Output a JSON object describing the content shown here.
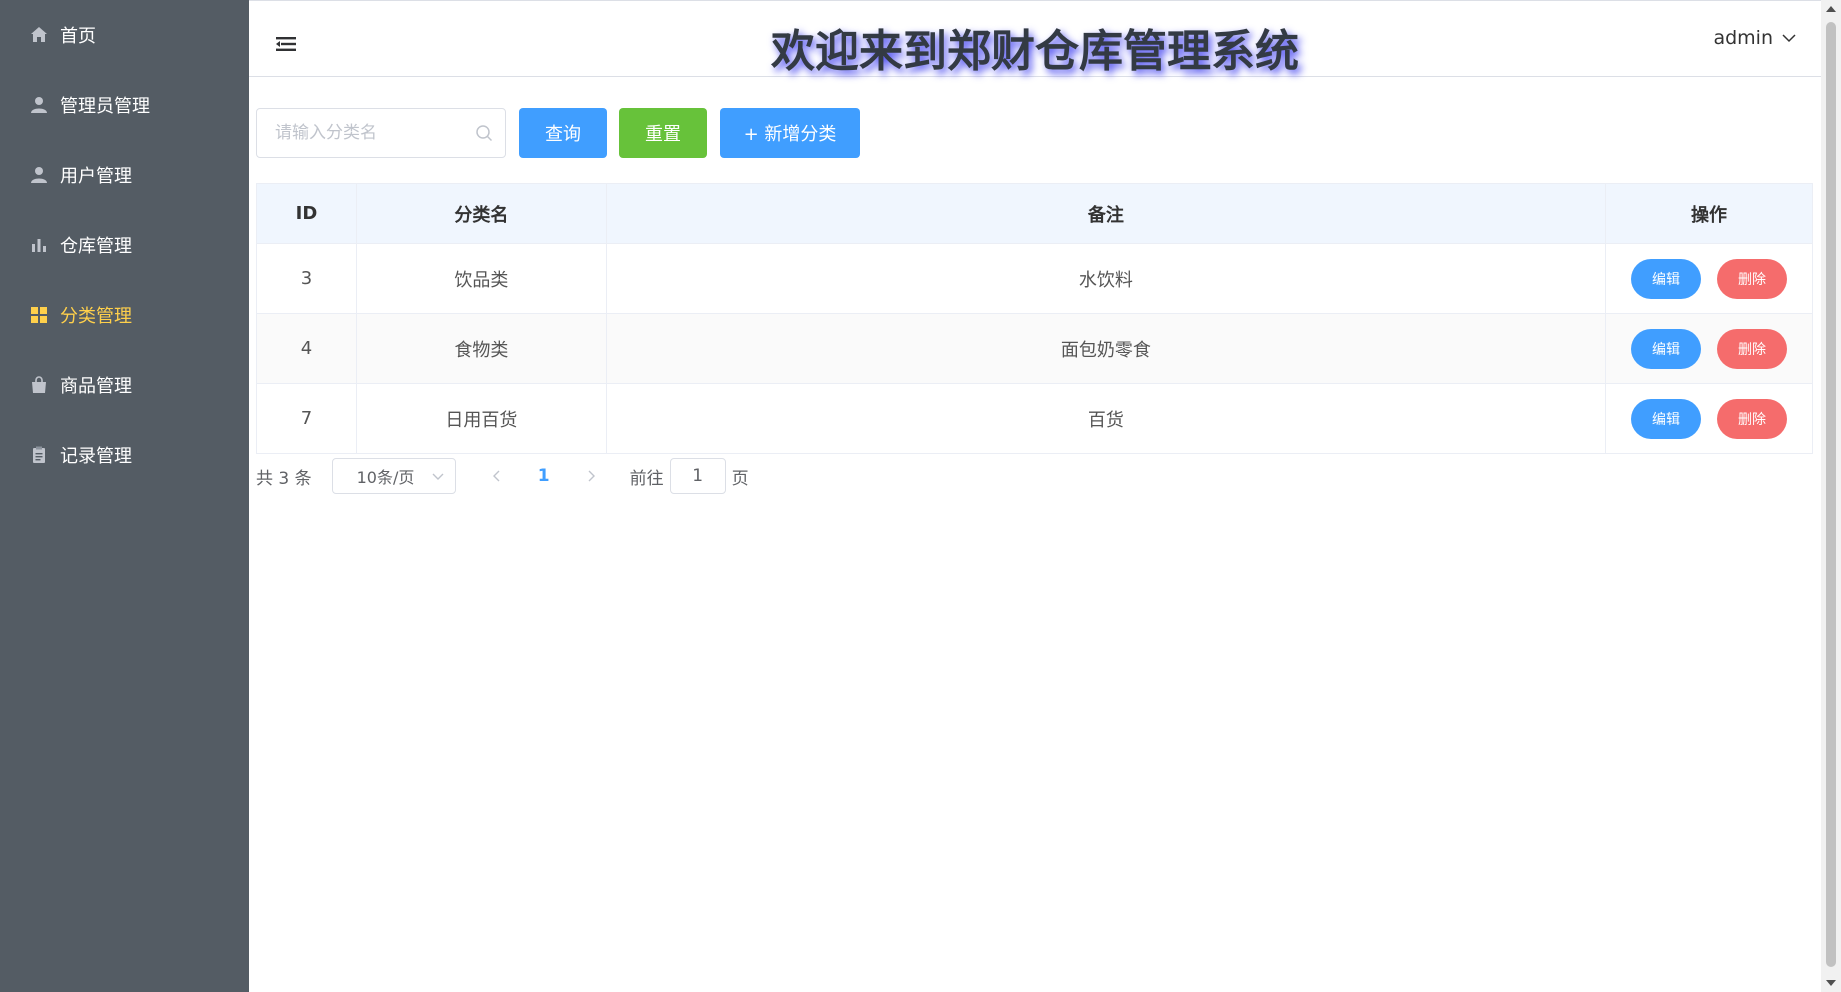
{
  "sidebar": {
    "items": [
      {
        "label": "首页",
        "icon": "home-icon",
        "active": false
      },
      {
        "label": "管理员管理",
        "icon": "user-icon",
        "active": false
      },
      {
        "label": "用户管理",
        "icon": "user-icon",
        "active": false
      },
      {
        "label": "仓库管理",
        "icon": "bar-chart-icon",
        "active": false
      },
      {
        "label": "分类管理",
        "icon": "grid-icon",
        "active": true
      },
      {
        "label": "商品管理",
        "icon": "shopping-bag-icon",
        "active": false
      },
      {
        "label": "记录管理",
        "icon": "clipboard-icon",
        "active": false
      }
    ],
    "bg_color": "#545c64",
    "active_color": "#ffd04b"
  },
  "header": {
    "title": "欢迎来到郑财仓库管理系统",
    "user": "admin"
  },
  "toolbar": {
    "search_placeholder": "请输入分类名",
    "search_value": "",
    "query_label": "查询",
    "reset_label": "重置",
    "add_label": "+ 新增分类"
  },
  "table": {
    "headers": [
      "ID",
      "分类名",
      "备注",
      "操作"
    ],
    "rows": [
      {
        "id": "3",
        "name": "饮品类",
        "remark": "水饮料"
      },
      {
        "id": "4",
        "name": "食物类",
        "remark": "面包奶零食"
      },
      {
        "id": "7",
        "name": "日用百货",
        "remark": "百货"
      }
    ],
    "edit_label": "编辑",
    "delete_label": "删除"
  },
  "pagination": {
    "total_text": "共 3 条",
    "page_size": "10条/页",
    "current_page": "1",
    "goto_label": "前往",
    "goto_value": "1",
    "page_unit": "页"
  },
  "colors": {
    "primary": "#409eff",
    "success": "#67c23a",
    "danger": "#f56c6c"
  }
}
